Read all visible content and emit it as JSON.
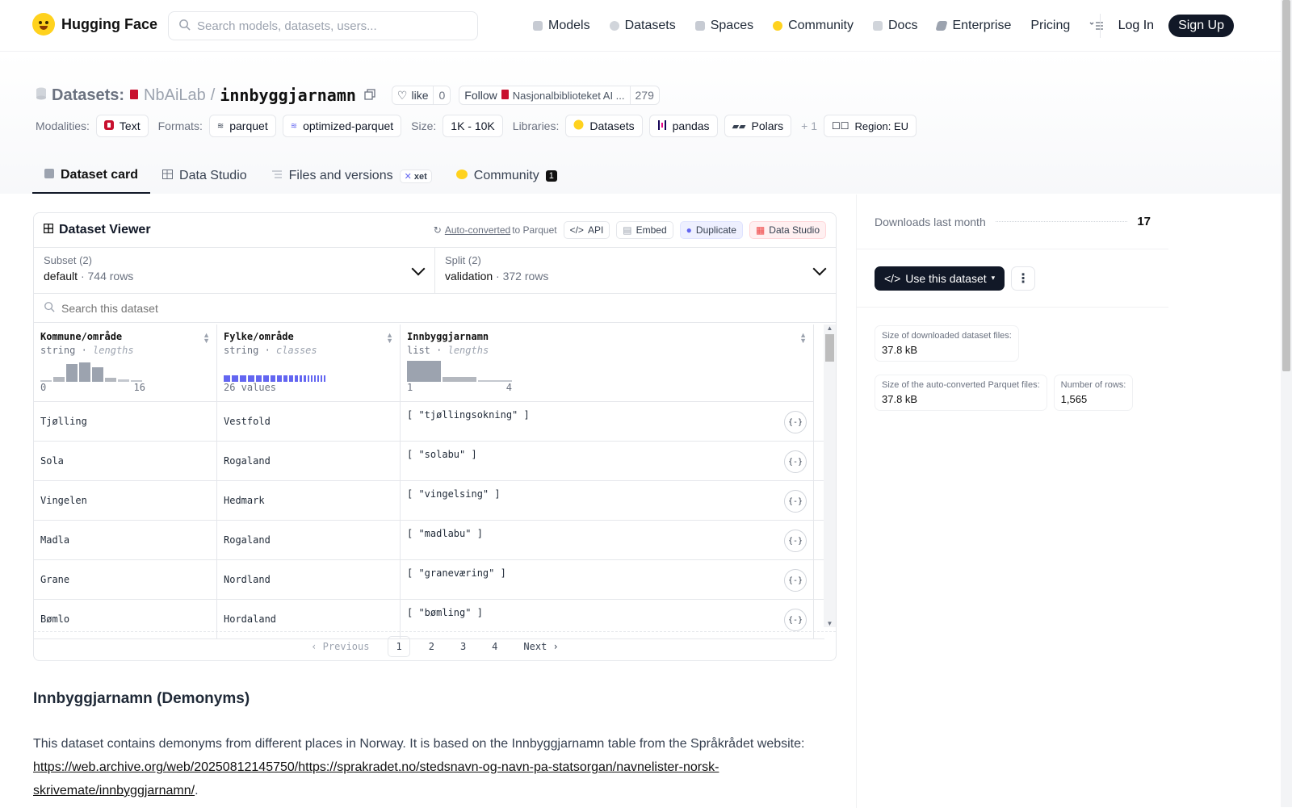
{
  "nav": {
    "brand": "Hugging Face",
    "search_placeholder": "Search models, datasets, users...",
    "links": [
      "Models",
      "Datasets",
      "Spaces",
      "Community",
      "Docs",
      "Enterprise",
      "Pricing"
    ],
    "login": "Log In",
    "signup": "Sign Up"
  },
  "header": {
    "section": "Datasets:",
    "owner": "NbAiLab",
    "sep": "/",
    "name": "innbyggjarnamn",
    "like": "like",
    "like_count": "0",
    "follow": "Follow",
    "follow_org": "Nasjonalbiblioteket AI ...",
    "follow_count": "279"
  },
  "tags": {
    "modalities_label": "Modalities:",
    "modality": "Text",
    "formats_label": "Formats:",
    "format1": "parquet",
    "format2": "optimized-parquet",
    "size_label": "Size:",
    "size": "1K - 10K",
    "libraries_label": "Libraries:",
    "lib1": "Datasets",
    "lib2": "pandas",
    "lib3": "Polars",
    "more": "+ 1",
    "region": "Region: EU"
  },
  "tabs": {
    "card": "Dataset card",
    "studio": "Data Studio",
    "files": "Files and versions",
    "xet": "xet",
    "community": "Community",
    "community_count": "1"
  },
  "viewer": {
    "title": "Dataset Viewer",
    "autoconv": "Auto-converted",
    "to_parquet": "to Parquet",
    "api": "API",
    "embed": "Embed",
    "duplicate": "Duplicate",
    "studio": "Data Studio",
    "subset_label": "Subset (2)",
    "subset_value": "default",
    "subset_rows": "744 rows",
    "split_label": "Split (2)",
    "split_value": "validation",
    "split_rows": "372 rows",
    "search_placeholder": "Search this dataset",
    "columns": [
      {
        "name": "Kommune/område",
        "type": "string",
        "stat": "lengths",
        "min": "0",
        "max": "16"
      },
      {
        "name": "Fylke/område",
        "type": "string",
        "stat": "classes",
        "values": "26 values"
      },
      {
        "name": "Innbyggjarnamn",
        "type": "list",
        "stat": "lengths",
        "min": "1",
        "max": "4"
      }
    ],
    "rows": [
      [
        "Tjølling",
        "Vestfold",
        "[ \"tjøllingsokning\" ]"
      ],
      [
        "Sola",
        "Rogaland",
        "[ \"solabu\" ]"
      ],
      [
        "Vingelen",
        "Hedmark",
        "[ \"vingelsing\" ]"
      ],
      [
        "Madla",
        "Rogaland",
        "[ \"madlabu\" ]"
      ],
      [
        "Grane",
        "Nordland",
        "[ \"graneværing\" ]"
      ],
      [
        "Bømlo",
        "Hordaland",
        "[ \"bømling\" ]"
      ]
    ],
    "json_btn": "{-}",
    "pager": {
      "prev": "Previous",
      "p1": "1",
      "p2": "2",
      "p3": "3",
      "p4": "4",
      "next": "Next"
    }
  },
  "readme": {
    "title": "Innbyggjarnamn (Demonyms)",
    "text": "This dataset contains demonyms from different places in Norway. It is based on the Innbyggjarnamn table from the Språkrådet website: ",
    "link": "https://web.archive.org/web/20250812145750/https://sprakradet.no/stedsnavn-og-navn-pa-statsorgan/navnelister-norsk-skrivemate/innbyggjarnamn/",
    "end": "."
  },
  "side": {
    "downloads_label": "Downloads last month",
    "downloads": "17",
    "use_dataset": "Use this dataset",
    "size_dl_label": "Size of downloaded dataset files:",
    "size_dl": "37.8 kB",
    "size_pq_label": "Size of the auto-converted Parquet files:",
    "size_pq": "37.8 kB",
    "rows_label": "Number of rows:",
    "rows": "1,565"
  },
  "colors": {
    "accent": "#111827",
    "hf_yellow": "#ffd21e",
    "histogram": "#9ca3af",
    "classes": "#6366f1"
  }
}
